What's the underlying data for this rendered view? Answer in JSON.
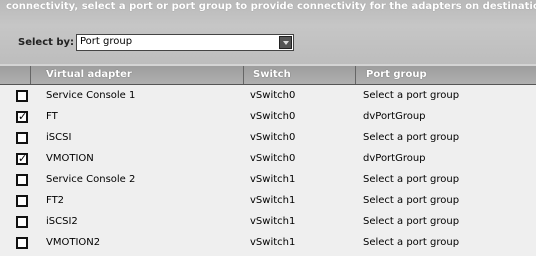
{
  "instruction": "connectivity, select a port or port group to provide connectivity for the adapters on destination.",
  "select_by": {
    "label": "Select by:",
    "value": "Port group"
  },
  "table": {
    "headers": {
      "adapter": "Virtual adapter",
      "switch": "Switch",
      "port_group": "Port group"
    },
    "rows": [
      {
        "checked": false,
        "adapter": "Service Console 1",
        "switch": "vSwitch0",
        "port_group": "Select a port group"
      },
      {
        "checked": true,
        "adapter": "FT",
        "switch": "vSwitch0",
        "port_group": "dvPortGroup"
      },
      {
        "checked": false,
        "adapter": "iSCSI",
        "switch": "vSwitch0",
        "port_group": "Select a port group"
      },
      {
        "checked": true,
        "adapter": "VMOTION",
        "switch": "vSwitch0",
        "port_group": "dvPortGroup"
      },
      {
        "checked": false,
        "adapter": "Service Console 2",
        "switch": "vSwitch1",
        "port_group": "Select a port group"
      },
      {
        "checked": false,
        "adapter": "FT2",
        "switch": "vSwitch1",
        "port_group": "Select a port group"
      },
      {
        "checked": false,
        "adapter": "iSCSI2",
        "switch": "vSwitch1",
        "port_group": "Select a port group"
      },
      {
        "checked": false,
        "adapter": "VMOTION2",
        "switch": "vSwitch1",
        "port_group": "Select a port group"
      }
    ]
  }
}
